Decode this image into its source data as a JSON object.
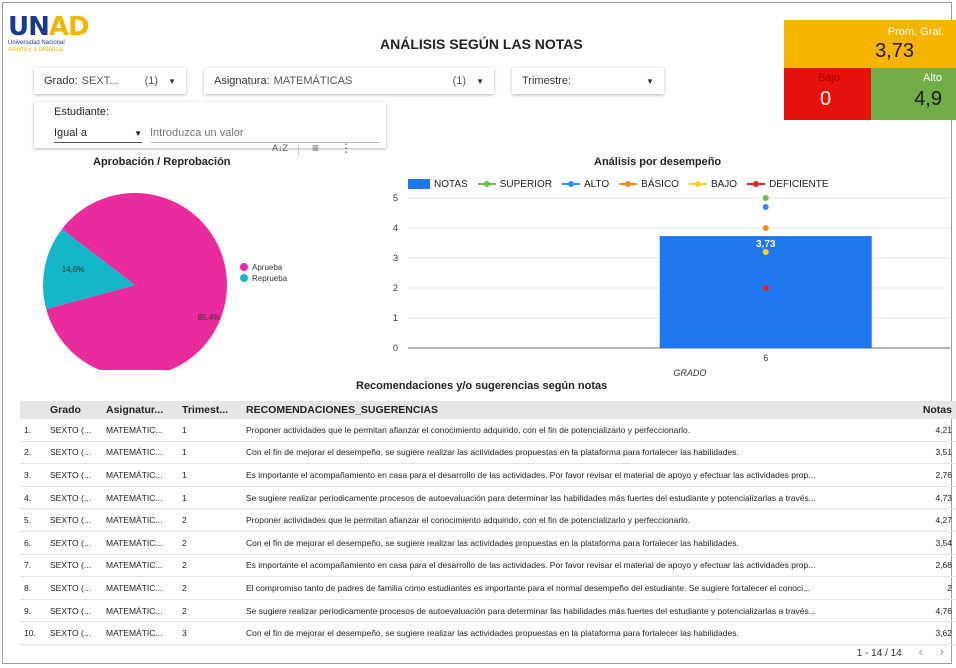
{
  "logo": {
    "text_main": "UN",
    "text_accent": "AD",
    "line1": "Universidad Nacional",
    "line2": "Abierta y a Distancia"
  },
  "title": "ANÁLISIS SEGÚN LAS NOTAS",
  "kpis": {
    "prom": {
      "label": "Prom. Gral.",
      "value": "3,73",
      "color": "#f5b400"
    },
    "bajo": {
      "label": "Bajo",
      "value": "0",
      "color": "#e8120c"
    },
    "alto": {
      "label": "Alto",
      "value": "4,9",
      "color": "#71ad47"
    }
  },
  "filters": {
    "grado": {
      "label": "Grado:",
      "value": "SEXT...",
      "count": "(1)"
    },
    "asignatura": {
      "label": "Asignatura:",
      "value": "MATEMÁTICAS",
      "count": "(1)"
    },
    "trimestre": {
      "label": "Trimestre:",
      "value": "",
      "count": ""
    }
  },
  "student": {
    "label": "Estudiante:",
    "operator": "Igual a",
    "placeholder": "Introduzca un valor"
  },
  "pie": {
    "title": "Aprobación / Reprobación",
    "chart_data": {
      "type": "pie",
      "labels": [
        "Aprueba",
        "Reprueba"
      ],
      "values": [
        85.4,
        14.6
      ],
      "value_labels": [
        "85,4%",
        "14,6%"
      ],
      "colors": [
        "#ea2b9e",
        "#14b7c9"
      ]
    }
  },
  "bar": {
    "title": "Análisis por desempeño",
    "chart_data": {
      "type": "bar",
      "categories": [
        "6"
      ],
      "xlabel": "GRADO",
      "ylim": [
        0,
        5
      ],
      "yticks": [
        "0",
        "1",
        "2",
        "3",
        "4",
        "5"
      ],
      "series": [
        {
          "name": "NOTAS",
          "kind": "bar",
          "values": [
            3.73
          ],
          "label": "3,73",
          "color": "#1f77f0"
        },
        {
          "name": "SUPERIOR",
          "kind": "line",
          "values": [
            5
          ],
          "color": "#6cbf4a"
        },
        {
          "name": "ALTO",
          "kind": "line",
          "values": [
            4.7
          ],
          "color": "#2f8ef3"
        },
        {
          "name": "BÁSICO",
          "kind": "line",
          "values": [
            4
          ],
          "color": "#f58c15"
        },
        {
          "name": "BAJO",
          "kind": "line",
          "values": [
            3.2
          ],
          "color": "#f7d229"
        },
        {
          "name": "DEFICIENTE",
          "kind": "line",
          "values": [
            2
          ],
          "color": "#e8201e"
        }
      ]
    }
  },
  "table": {
    "title": "Recomendaciones y/o sugerencias según notas",
    "headers": [
      "",
      "Grado",
      "Asignatur...",
      "Trimest...",
      "RECOMENDACIONES_SUGERENCIAS",
      "Notas"
    ],
    "rows": [
      [
        "1.",
        "SEXTO (...",
        "MATEMÁTIC...",
        "1",
        "Proponer actividades que le permitan afianzar el conocimiento adquirido, con el fin de potencializarlo y perfeccionarlo.",
        "4,21"
      ],
      [
        "2.",
        "SEXTO (...",
        "MATEMÁTIC...",
        "1",
        "Con el fin de mejorar el desempeño, se sugiere realizar las actividades propuestas en la plataforma para fortalecer las habilidades.",
        "3,51"
      ],
      [
        "3.",
        "SEXTO (...",
        "MATEMÁTIC...",
        "1",
        "Es importante el acompañamiento en casa para el desarrollo de las actividades. Por favor revisar el material de apoyo y efectuar las actividades prop...",
        "2,76"
      ],
      [
        "4.",
        "SEXTO (...",
        "MATEMÁTIC...",
        "1",
        "Se sugiere realizar periodicamente procesos de autoevaluación para determinar las habilidades más fuertes del estudiante y potencializarlas a través...",
        "4,73"
      ],
      [
        "5.",
        "SEXTO (...",
        "MATEMÁTIC...",
        "2",
        "Proponer actividades que le permitan afianzar el conocimiento adquirido, con el fin de potencializarlo y perfeccionarlo.",
        "4,27"
      ],
      [
        "6.",
        "SEXTO (...",
        "MATEMÁTIC...",
        "2",
        "Con el fin de mejorar el desempeño, se sugiere realizar las actividades propuestas en la plataforma para fortalecer las habilidades.",
        "3,54"
      ],
      [
        "7.",
        "SEXTO (...",
        "MATEMÁTIC...",
        "2",
        "Es importante el acompañamiento en casa para el desarrollo de las actividades. Por favor revisar el material de apoyo y efectuar las actividades prop...",
        "2,68"
      ],
      [
        "8.",
        "SEXTO (...",
        "MATEMÁTIC...",
        "2",
        "El compromiso tanto de padres de familia como estudiantes es importante para el normal desempeño del estudiante. Se sugiere fortalecer el conoci...",
        "2"
      ],
      [
        "9.",
        "SEXTO (...",
        "MATEMÁTIC...",
        "2",
        "Se sugiere realizar periodicamente procesos de autoevaluación para determinar las habilidades más fuertes del estudiante y potencializarlas a través...",
        "4,76"
      ],
      [
        "10.",
        "SEXTO (...",
        "MATEMÁTIC...",
        "3",
        "Con el fin de mejorar el desempeño, se sugiere realizar las actividades propuestas en la plataforma para fortalecer las habilidades.",
        "3,62"
      ]
    ],
    "pagination": "1 - 14 / 14"
  }
}
